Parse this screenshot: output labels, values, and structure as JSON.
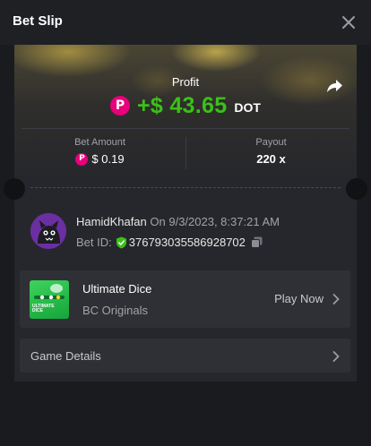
{
  "header": {
    "title": "Bet Slip",
    "close_icon": "close-icon"
  },
  "profit": {
    "label": "Profit",
    "coin_icon": "polkadot-coin-icon",
    "value": "+$ 43.65",
    "unit": "DOT",
    "share_icon": "share-icon"
  },
  "stats": {
    "bet_amount_label": "Bet Amount",
    "bet_amount_value": "$ 0.19",
    "payout_label": "Payout",
    "payout_value": "220 x"
  },
  "user": {
    "name": "HamidKhafan",
    "timestamp": "On 9/3/2023, 8:37:21 AM",
    "bet_id_label": "Bet ID:",
    "bet_id": "376793035586928702",
    "verified_icon": "shield-check-icon",
    "copy_icon": "copy-icon"
  },
  "game": {
    "name": "Ultimate Dice",
    "provider": "BC Originals",
    "play_label": "Play Now",
    "thumb_text_1": "ULTIMATE",
    "thumb_text_2": "DICE"
  },
  "details": {
    "label": "Game Details"
  },
  "colors": {
    "accent_green": "#3bc117",
    "polkadot_pink": "#e6007a",
    "background": "#1a1b1e",
    "card": "#26272c"
  }
}
